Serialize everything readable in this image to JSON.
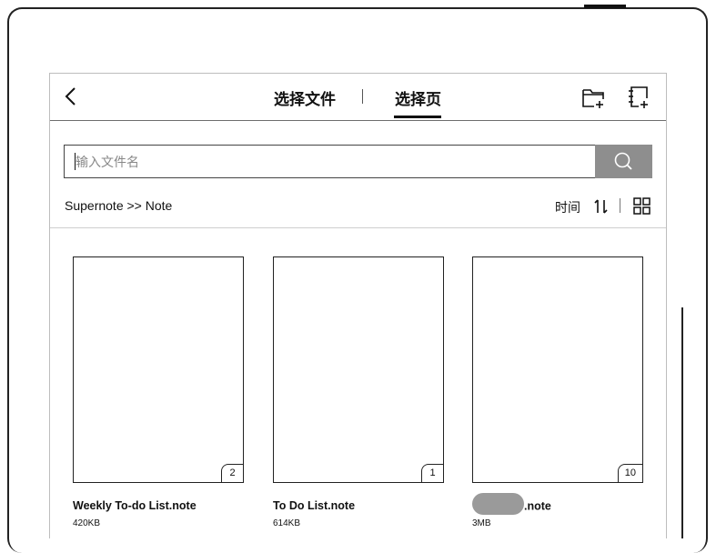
{
  "header": {
    "tab_files": "选择文件",
    "tab_pages": "选择页",
    "active_tab": "选择页"
  },
  "search": {
    "placeholder": "输入文件名",
    "value": ""
  },
  "breadcrumb": "Supernote >> Note",
  "sort": {
    "label": "时间"
  },
  "files": [
    {
      "name": "Weekly To-do List.note",
      "size": "420KB",
      "pages": "2"
    },
    {
      "name": "To Do List.note",
      "size": "614KB",
      "pages": "1"
    },
    {
      "name": ".note",
      "size": "3MB",
      "pages": "10",
      "name_redacted": true
    }
  ],
  "icons": {
    "back": "chevron-left-icon",
    "new_folder": "new-folder-icon",
    "new_note": "new-note-icon",
    "search": "search-icon",
    "sort": "sort-icon",
    "view": "grid-view-icon"
  }
}
